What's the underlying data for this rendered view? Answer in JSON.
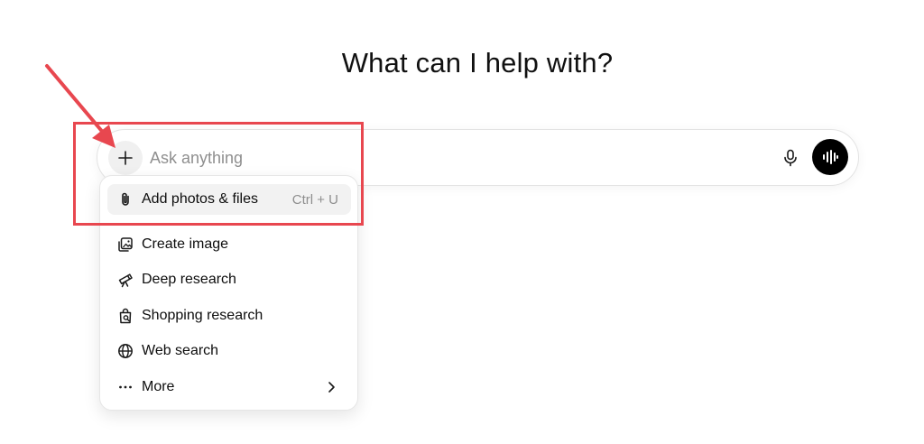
{
  "heading": "What can I help with?",
  "composer": {
    "placeholder": "Ask anything",
    "plus_icon": "plus-icon",
    "mic_icon": "microphone-icon",
    "voice_icon": "voice-waveform-icon"
  },
  "menu": {
    "items": [
      {
        "label": "Add photos & files",
        "shortcut": "Ctrl + U",
        "icon": "paperclip-icon"
      },
      {
        "label": "Create image",
        "icon": "image-icon"
      },
      {
        "label": "Deep research",
        "icon": "telescope-icon"
      },
      {
        "label": "Shopping research",
        "icon": "shopping-bag-icon"
      },
      {
        "label": "Web search",
        "icon": "globe-icon"
      },
      {
        "label": "More",
        "icon": "ellipsis-icon"
      }
    ]
  },
  "annotation": {
    "color": "#e8474f"
  }
}
